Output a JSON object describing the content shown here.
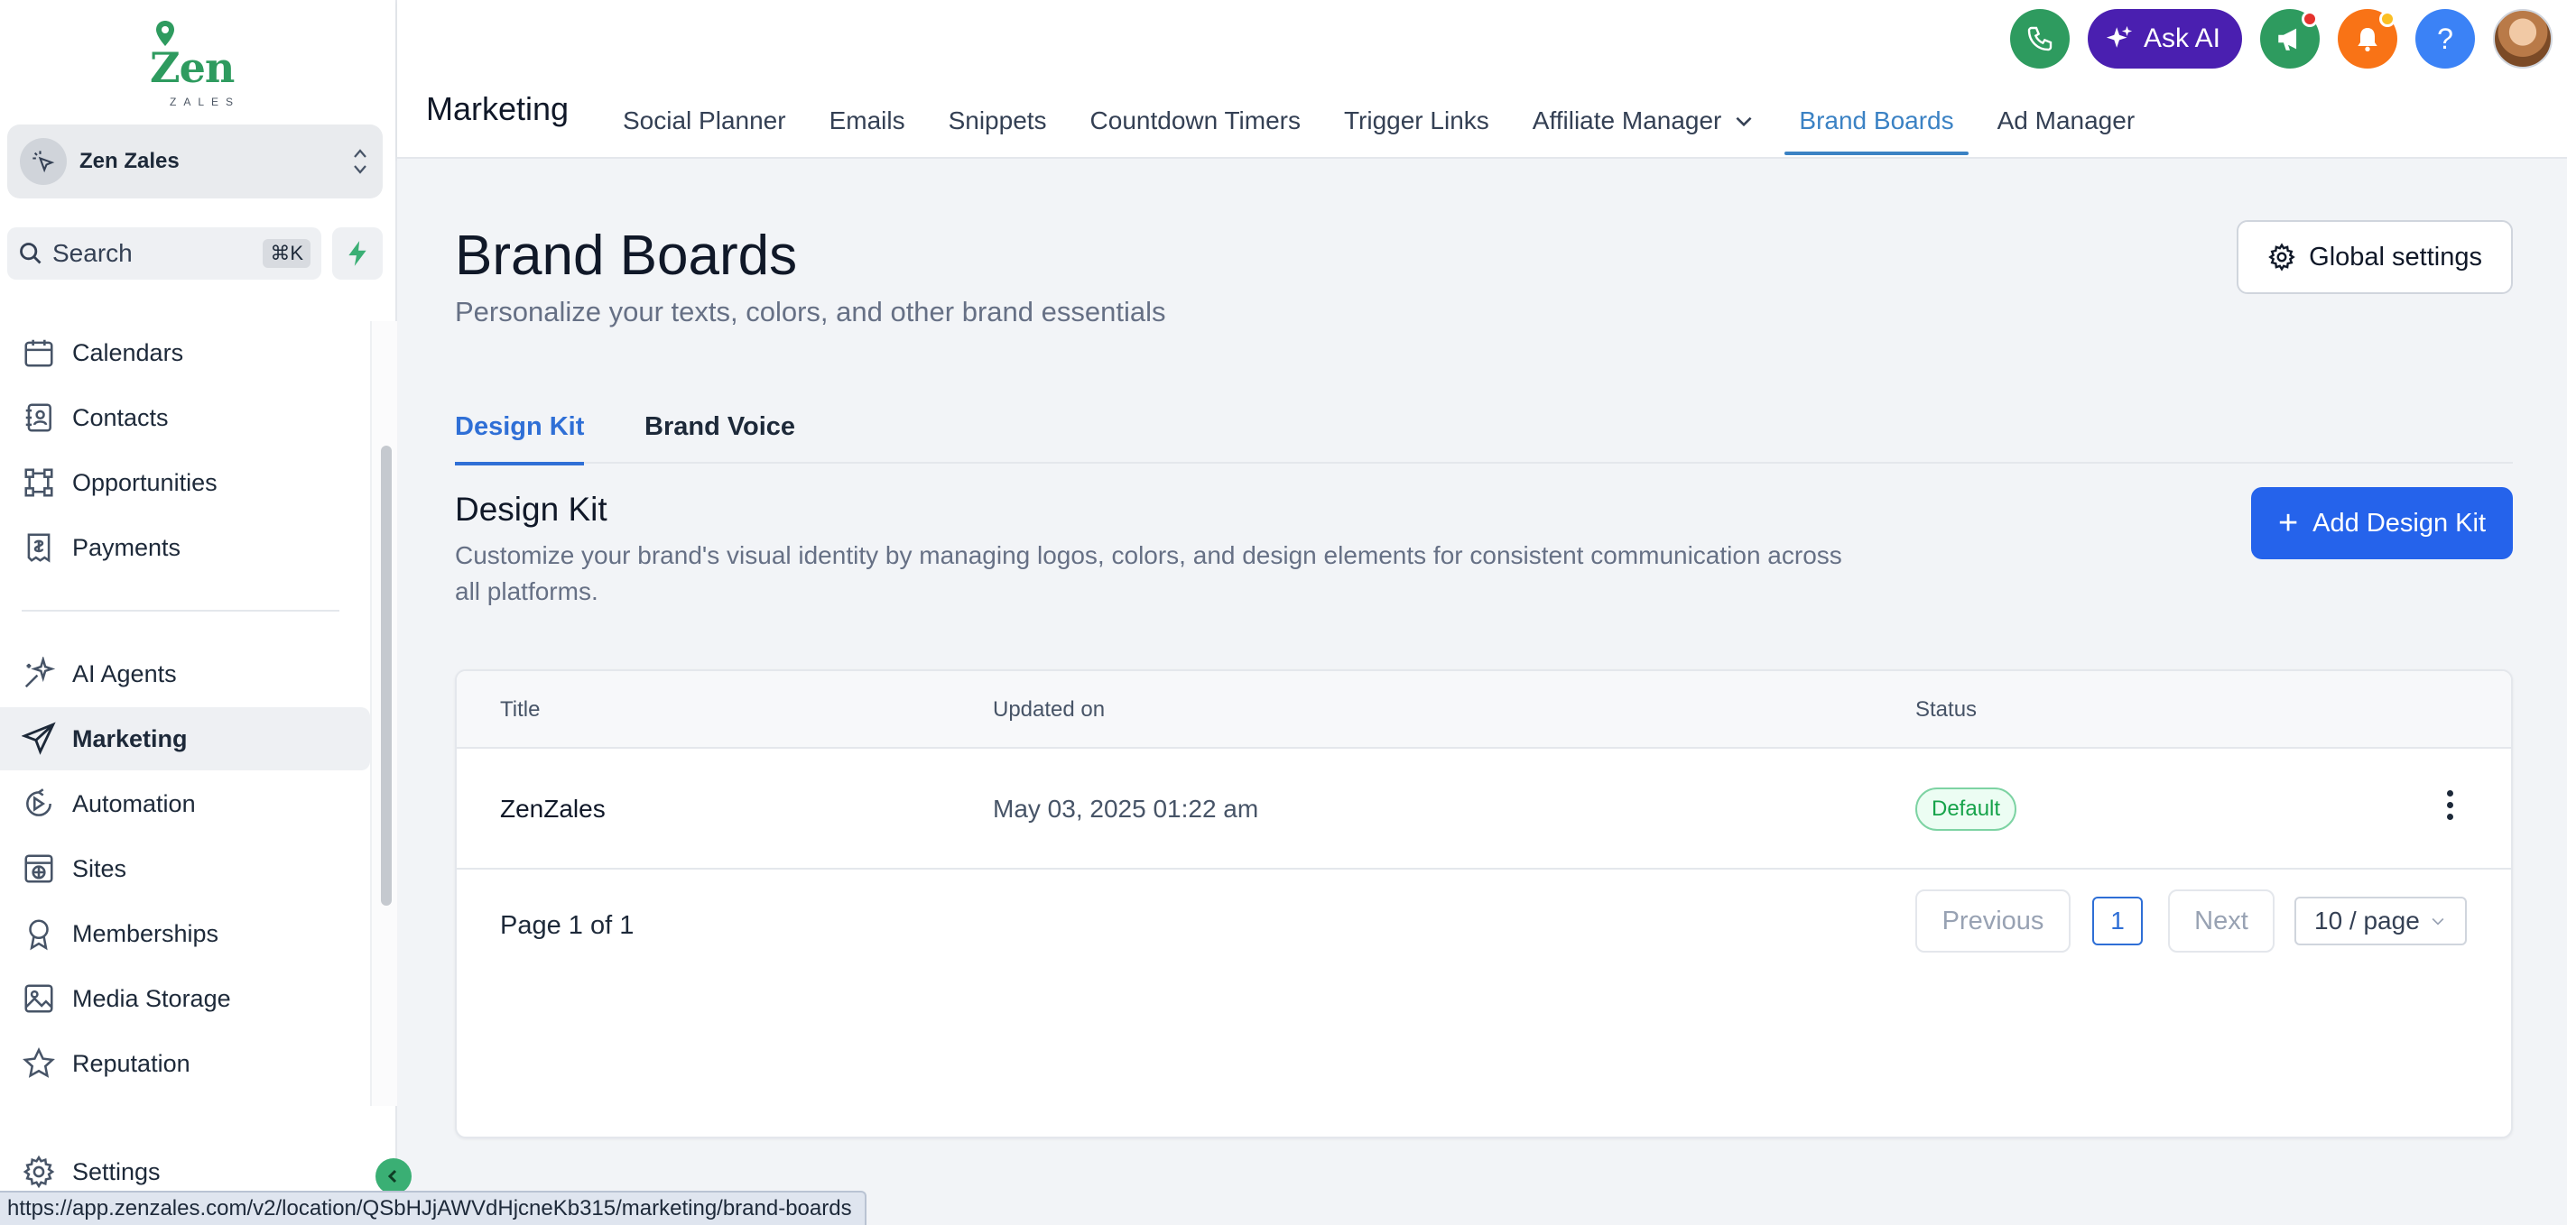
{
  "brand": {
    "logo_text": "Zen",
    "logo_sub": "ZALES",
    "accent_color": "#2e9b5f"
  },
  "account": {
    "name": "Zen Zales"
  },
  "search": {
    "label": "Search",
    "shortcut": "⌘K"
  },
  "sidebar": {
    "items": [
      {
        "label": "Calendars",
        "icon": "calendar-icon"
      },
      {
        "label": "Contacts",
        "icon": "contacts-icon"
      },
      {
        "label": "Opportunities",
        "icon": "opportunities-icon"
      },
      {
        "label": "Payments",
        "icon": "payments-icon"
      },
      {
        "label": "AI Agents",
        "icon": "sparkle-icon"
      },
      {
        "label": "Marketing",
        "icon": "send-icon",
        "active": true
      },
      {
        "label": "Automation",
        "icon": "automation-icon"
      },
      {
        "label": "Sites",
        "icon": "sites-icon"
      },
      {
        "label": "Memberships",
        "icon": "award-icon"
      },
      {
        "label": "Media Storage",
        "icon": "image-icon"
      },
      {
        "label": "Reputation",
        "icon": "star-icon"
      }
    ],
    "settings_label": "Settings"
  },
  "topbar": {
    "section_title": "Marketing",
    "tabs": [
      {
        "label": "Social Planner"
      },
      {
        "label": "Emails"
      },
      {
        "label": "Snippets"
      },
      {
        "label": "Countdown Timers"
      },
      {
        "label": "Trigger Links"
      },
      {
        "label": "Affiliate Manager",
        "has_dropdown": true
      },
      {
        "label": "Brand Boards",
        "active": true
      },
      {
        "label": "Ad Manager"
      }
    ],
    "ask_ai_label": "Ask AI",
    "help_label": "?"
  },
  "page": {
    "title": "Brand Boards",
    "subtitle": "Personalize your texts, colors, and other brand essentials",
    "global_settings_label": "Global settings",
    "sub_tabs": [
      {
        "label": "Design Kit",
        "active": true
      },
      {
        "label": "Brand Voice"
      }
    ],
    "section_title": "Design Kit",
    "section_desc": "Customize your brand's visual identity by managing logos, colors, and design elements for consistent communication across all platforms.",
    "add_button_label": "Add Design Kit"
  },
  "table": {
    "headers": {
      "title": "Title",
      "updated_on": "Updated on",
      "status": "Status"
    },
    "rows": [
      {
        "title": "ZenZales",
        "updated_on": "May 03, 2025 01:22 am",
        "status": "Default"
      }
    ]
  },
  "pagination": {
    "info": "Page 1 of 1",
    "previous_label": "Previous",
    "current_page": "1",
    "next_label": "Next",
    "page_size": "10 / page"
  },
  "status_bar": {
    "url": "https://app.zenzales.com/v2/location/QSbHJjAWVdHjcneKb315/marketing/brand-boards"
  },
  "colors": {
    "primary_blue": "#2563eb",
    "active_tab": "#3b82c4",
    "ask_ai_purple": "#4a1fb0",
    "phone_green": "#2e9b5f",
    "notification_orange": "#f97316",
    "help_blue": "#3b82f6",
    "status_green": "#16a34a"
  }
}
